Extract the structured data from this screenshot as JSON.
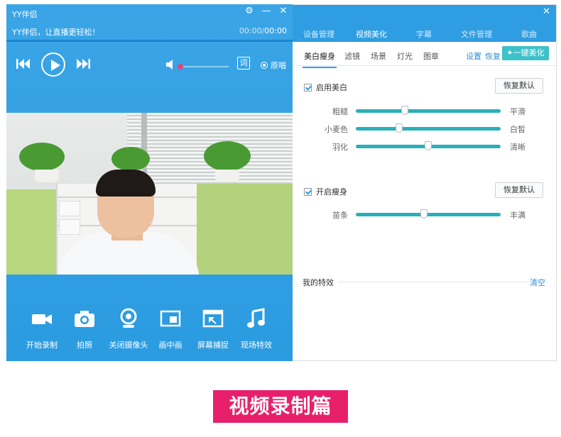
{
  "player": {
    "app_title": "YY伴侣",
    "song_title": "YY伴侣，让直播更轻松！",
    "time_current": "00:00",
    "time_total": "00:00",
    "progress": 0,
    "volume": 0,
    "lyric_label": "词",
    "original_label": "原唱"
  },
  "toolbar": {
    "items": [
      {
        "label": "开始录制",
        "icon": "video-camera-icon"
      },
      {
        "label": "拍照",
        "icon": "camera-icon"
      },
      {
        "label": "关闭摄像头",
        "icon": "webcam-icon"
      },
      {
        "label": "画中画",
        "icon": "picture-in-picture-icon"
      },
      {
        "label": "屏幕捕捉",
        "icon": "screen-capture-icon"
      },
      {
        "label": "现场特效",
        "icon": "music-note-icon"
      }
    ]
  },
  "panel": {
    "tabs": [
      "设备管理",
      "视频美化",
      "字幕",
      "文件管理",
      "歌曲"
    ],
    "active_tab": 1,
    "subtabs": [
      "美白瘦身",
      "滤镜",
      "场景",
      "灯光",
      "图章"
    ],
    "active_subtab": 0,
    "settings_label": "设置",
    "restore_label": "恢复",
    "one_key_label": "一键美化",
    "whitening": {
      "label": "启用美白",
      "reset": "恢复默认",
      "sliders": [
        {
          "left": "粗糙",
          "right": "平滑",
          "value": 0.34
        },
        {
          "left": "小麦色",
          "right": "白皙",
          "value": 0.3
        },
        {
          "left": "羽化",
          "right": "清晰",
          "value": 0.5
        }
      ]
    },
    "slimming": {
      "label": "开启瘦身",
      "reset": "恢复默认",
      "sliders": [
        {
          "left": "苗条",
          "right": "丰满",
          "value": 0.47
        }
      ]
    },
    "my_effects": "我的特效",
    "clear": "清空"
  },
  "banner": "视频录制篇",
  "colors": {
    "accent": "#2f9de2",
    "teal": "#29b0b8",
    "banner": "#e8206c"
  }
}
